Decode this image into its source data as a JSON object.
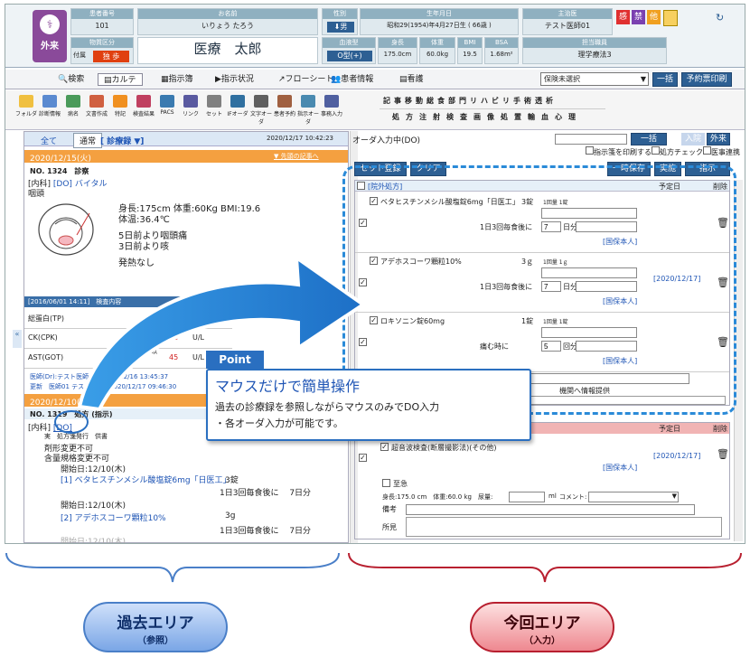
{
  "header": {
    "dept": "外来",
    "patient_no_label": "患者番号",
    "patient_no": "101",
    "kana_label": "お名前",
    "kana": "いりょう たろう",
    "name": "医療　太郎",
    "sex_label": "性別",
    "sex": "男",
    "birth_label": "生年月日",
    "birth": "昭和29(1954)年4月27日生 ( 66歳 )",
    "blood_label": "血液型",
    "blood": "O型(+)",
    "insurance_label": "物質区分",
    "insurance_badge": "独 歩",
    "insurance_sub": "付属",
    "height_label": "身長",
    "height": "175.0cm",
    "weight_label": "体重",
    "weight": "60.0kg",
    "bmi_label": "BMI",
    "bmi": "19.5",
    "bsa_label": "BSA",
    "bsa": "1.68m²",
    "doctor_label": "主治医",
    "doctor": "テスト医師01",
    "staff_label": "担当職員",
    "staff": "理学療法3",
    "badges": [
      "感",
      "禁",
      "他"
    ],
    "refresh_icon": "refresh-icon"
  },
  "menu": {
    "items": [
      "検索",
      "カルテ",
      "指示簿",
      "指示状況",
      "フローシート",
      "患者情報",
      "看護"
    ],
    "insurance_select": "保険未選択",
    "bulk_button": "一括",
    "print_button": "予約票印刷"
  },
  "toolbar": {
    "tools": [
      "フォルダ",
      "診断情報",
      "病名",
      "文書作成",
      "特記",
      "検査結果",
      "PACS",
      "リンク",
      "セット",
      "IFオーダ",
      "文字オーダ",
      "患者予約",
      "指示オーダ",
      "事務入力"
    ],
    "order_row1": [
      "記",
      "事",
      "移",
      "動",
      "総",
      "食",
      "部",
      "門",
      "リ",
      "ハ",
      "ビ",
      "リ",
      "手",
      "術",
      "透",
      "析"
    ],
    "order_row2": [
      "処",
      "方",
      "注",
      "射",
      "検",
      "査",
      "画",
      "像",
      "処",
      "置",
      "輸",
      "血",
      "心",
      "理"
    ]
  },
  "left": {
    "tabs": [
      "全て",
      "通常",
      "[ 診療録 ▼]"
    ],
    "timestamp": "2020/12/17 10:42:23",
    "entry1_date": "2020/12/15(火)",
    "entry1_link": "▼ 先頭の記事へ",
    "entry1_no": "NO. 1324　診察",
    "entry1_dept": "[内科]",
    "entry1_do": "[DO]",
    "entry1_vital": "バイタル",
    "entry1_note": "咽頭",
    "vital_line1": "身長:175cm 体重:60Kg BMI:19.6",
    "vital_line2": "体温:36.4℃",
    "symptom1": "5日前より咽頭痛",
    "symptom2": "3日前より咳",
    "symptom3": "発熱なし",
    "lab_header": "[2016/06/01 14:11]　検査内容",
    "lab_rows": [
      {
        "name": "総蛋白(TP)",
        "range": "",
        "value": "86",
        "unit": "g/dL"
      },
      {
        "name": "CK(CPK)",
        "range": "62 ～ 287 以下",
        "value": "66",
        "unit": "U/L"
      },
      {
        "name": "AST(GOT)",
        "range": "10 ～ 40 以下",
        "value": "45",
        "unit": "U/L"
      }
    ],
    "doctor_line": "医師(Dr):テスト医師　　2020/12/16 13:45:37",
    "update_line": "更新　医師01 テスト医師　2020/12/17 09:46:30",
    "entry2_date": "2020/12/10(木)",
    "entry2_no": "NO. 1319　処方 (指示)",
    "entry2_dept": "[内科]",
    "entry2_do": "[DO]",
    "entry2_lines": [
      "剤形変更不可",
      "含量規格変更不可"
    ],
    "entry2_partial": "実　処方箋発行　供書",
    "rx_start1": "開始日:12/10(木)",
    "rx1_name": "[1] ベタヒスチンメシル酸塩錠6mg「日医工」",
    "rx1_qty": "3錠",
    "rx1_usage": "1日3回毎食後に　 7日分",
    "rx_start2": "開始日:12/10(木)",
    "rx2_name": "[2] アデホスコーワ顆粒10%",
    "rx2_qty": "3g",
    "rx2_usage": "1日3回毎食後に　 7日分",
    "rx_start3": "開始日:12/10(木)"
  },
  "right": {
    "order_status": "オーダ入力中(DO)",
    "bulk_button": "一括",
    "inpatient_button": "入院",
    "outpatient_button": "外来",
    "checks": [
      "指示箋を印刷する",
      "処方チェック",
      "医事連携"
    ],
    "set_button": "セット登録",
    "clear_button": "クリア",
    "save_button": "一時保存",
    "exec_button": "実施",
    "instruct_button": "指示",
    "section1_title": "[院外処方]",
    "scheduled_label": "予定日",
    "delete_label": "削除",
    "scheduled_date": "[2020/12/17]",
    "meds": [
      {
        "name": "ベタヒスチンメシル酸塩錠6mg「日医工」",
        "qty": "3錠",
        "dose": "1回量 1錠",
        "usage": "1日3回毎食後に",
        "days": "7",
        "days_unit": "日分",
        "ins": "[国保本人]"
      },
      {
        "name": "アデホスコーワ顆粒10%",
        "qty": "3ｇ",
        "dose": "1回量 1ｇ",
        "usage": "1日3回毎食後に",
        "days": "7",
        "days_unit": "日分",
        "ins": "[国保本人]"
      },
      {
        "name": "ロキソニン錠60mg",
        "qty": "1錠",
        "dose": "1回量 1錠",
        "usage": "痛む時に",
        "days": "5",
        "days_unit": "回分",
        "ins": "[国保本人]"
      }
    ],
    "remarks_label": "備考",
    "info_label": "機関へ情報提供",
    "section2_date": "[2020/12/17]",
    "section2_item": "超音波検査(断層撮影法)(その他)",
    "section2_ins": "[国保本人]",
    "urgent_label": "至急",
    "vitals_line": "身長:175.0 cm　体重:60.0 kg　尿量:",
    "ml_label": "ml",
    "comment_label": "コメント:",
    "remarks2_label": "備考",
    "findings_label": "所見"
  },
  "callout": {
    "badge": "Point",
    "title": "マウスだけで簡単操作",
    "line1": "過去の診療録を参照しながらマウスのみでDO入力",
    "line2": "・各オーダ入力が可能です。"
  },
  "labels": {
    "past_title": "過去エリア",
    "past_sub": "（参照）",
    "current_title": "今回エリア",
    "current_sub": "（入力）"
  },
  "colors": {
    "accent": "#2d5f93",
    "orange": "#f4a040",
    "past": "#6f9fe0",
    "current": "#e86a70"
  }
}
